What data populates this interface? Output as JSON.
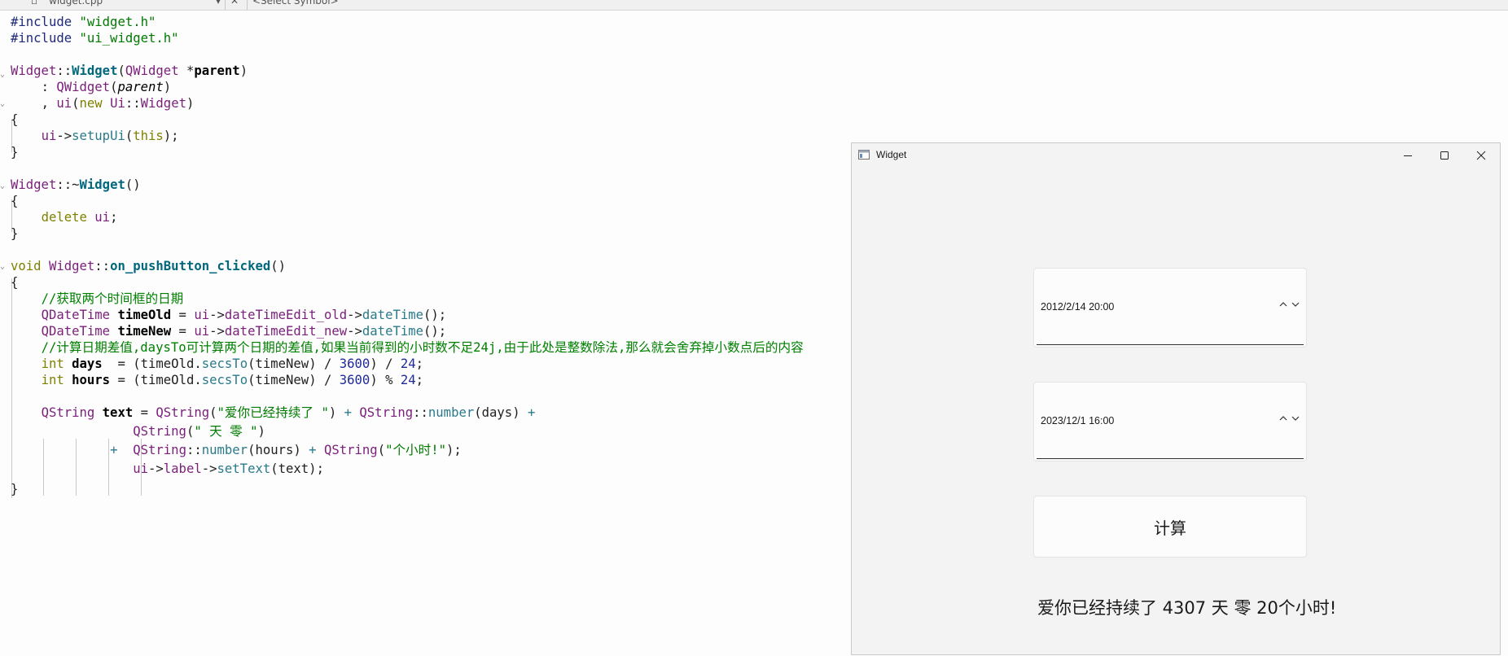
{
  "editor": {
    "tab_file": "widget.cpp",
    "tab_close": "✕",
    "symbol_selector": "<Select Symbol>"
  },
  "code": {
    "l1_dir": "#include",
    "l1_str": "\"widget.h\"",
    "l2_dir": "#include",
    "l2_str": "\"ui_widget.h\"",
    "l4_cls": "Widget",
    "l4_sep": "::",
    "l4_fn": "Widget",
    "l4_open": "(",
    "l4_type": "QWidget",
    "l4_ptr": " *",
    "l4_param": "parent",
    "l4_close": ")",
    "l5_colon": ": ",
    "l5_type": "QWidget",
    "l5_open": "(",
    "l5_param": "parent",
    "l5_close": ")",
    "l6_comma": ", ",
    "l6_member": "ui",
    "l6_open": "(",
    "l6_new": "new",
    "l6_sp": " ",
    "l6_ns": "Ui",
    "l6_sep": "::",
    "l6_type": "Widget",
    "l6_close": ")",
    "l7_brace": "{",
    "l8_ui": "ui",
    "l8_arrow": "->",
    "l8_method": "setupUi",
    "l8_open": "(",
    "l8_this": "this",
    "l8_close": ");",
    "l9_brace": "}",
    "l11_cls": "Widget",
    "l11_sep": "::~",
    "l11_fn": "Widget",
    "l11_parens": "()",
    "l12_brace": "{",
    "l13_delete": "delete",
    "l13_sp": " ",
    "l13_ui": "ui",
    "l13_semi": ";",
    "l14_brace": "}",
    "l16_void": "void",
    "l16_sp": " ",
    "l16_cls": "Widget",
    "l16_sep": "::",
    "l16_fn": "on_pushButton_clicked",
    "l16_parens": "()",
    "l17_brace": "{",
    "l18_comment": "//获取两个时间框的日期",
    "l19_type": "QDateTime",
    "l19_var": "timeOld",
    "l19_eq": " = ",
    "l19_ui": "ui",
    "l19_arrow": "->",
    "l19_obj": "dateTimeEdit_old",
    "l19_arrow2": "->",
    "l19_call": "dateTime",
    "l19_end": "();",
    "l20_type": "QDateTime",
    "l20_var": "timeNew",
    "l20_eq": " = ",
    "l20_ui": "ui",
    "l20_arrow": "->",
    "l20_obj": "dateTimeEdit_new",
    "l20_arrow2": "->",
    "l20_call": "dateTime",
    "l20_end": "();",
    "l21_comment": "//计算日期差值,daysTo可计算两个日期的差值,如果当前得到的小时数不足24j,由于此处是整数除法,那么就会舍弃掉小数点后的内容",
    "l22_int": "int",
    "l22_var": "days",
    "l22_a": "  = (timeOld.",
    "l22_call": "secsTo",
    "l22_b": "(timeNew) / ",
    "l22_n1": "3600",
    "l22_c": ") / ",
    "l22_n2": "24",
    "l22_d": ";",
    "l23_int": "int",
    "l23_var": "hours",
    "l23_a": " = (timeOld.",
    "l23_call": "secsTo",
    "l23_b": "(timeNew) / ",
    "l23_n1": "3600",
    "l23_c": ") % ",
    "l23_n2": "24",
    "l23_d": ";",
    "l25_type": "QString",
    "l25_var": "text",
    "l25_eq": " = ",
    "l25_t2": "QString",
    "l25_open": "(",
    "l25_str": "\"爱你已经持续了 \"",
    "l25_close": ")",
    "l25_plus": " + ",
    "l25_t3": "QString",
    "l25_sep": "::",
    "l25_call": "number",
    "l25_args": "(days)",
    "l25_plus2": " +",
    "l26_type": "QString",
    "l26_open": "(",
    "l26_str": "\" 天 零 \"",
    "l26_close": ")",
    "l27_plus": "+  ",
    "l27_type": "QString",
    "l27_sep": "::",
    "l27_call": "number",
    "l27_args": "(hours)",
    "l27_plus2": " + ",
    "l27_t2": "QString",
    "l27_open": "(",
    "l27_str": "\"个小时!\"",
    "l27_close": ");",
    "l28_ui": "ui",
    "l28_arrow": "->",
    "l28_obj": "label",
    "l28_arrow2": "->",
    "l28_call": "setText",
    "l28_args": "(text);",
    "l29_brace": "}"
  },
  "window": {
    "title": "Widget",
    "icons": {
      "app": "window-app-icon",
      "minimize": "minimize-icon",
      "maximize": "maximize-icon",
      "close": "close-icon"
    },
    "datetime_old": "2012/2/14 20:00",
    "datetime_new": "2023/12/1 16:00",
    "button_label": "计算",
    "result_label": "爱你已经持续了 4307 天 零 20个小时!"
  }
}
